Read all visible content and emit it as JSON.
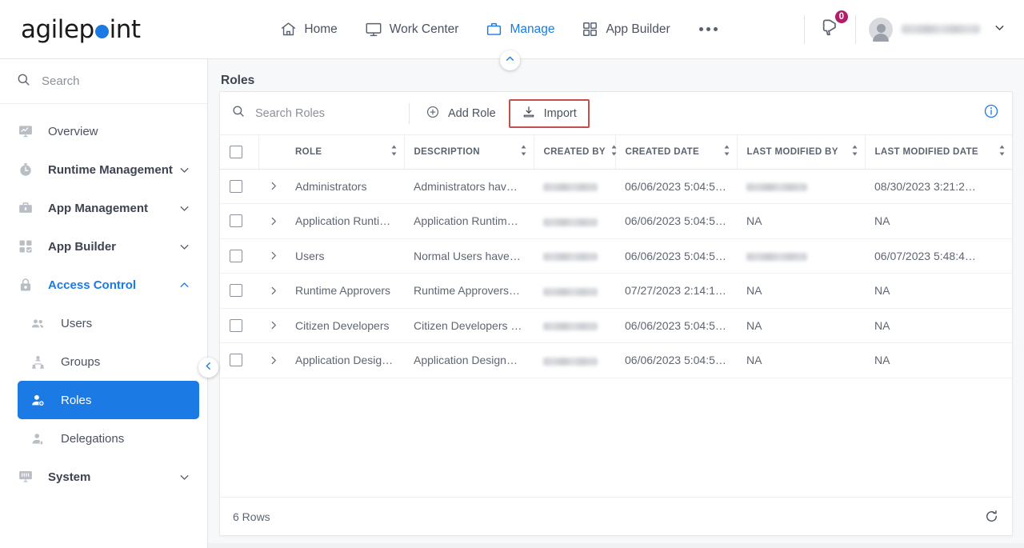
{
  "header": {
    "logo_text_pre": "agilep",
    "logo_text_post": "int",
    "nav": [
      {
        "label": "Home",
        "icon": "home-icon",
        "active": false
      },
      {
        "label": "Work Center",
        "icon": "monitor-icon",
        "active": false
      },
      {
        "label": "Manage",
        "icon": "briefcase-icon",
        "active": true
      },
      {
        "label": "App Builder",
        "icon": "grid-icon",
        "active": false
      }
    ],
    "overflow_label": "more-options",
    "notification_badge": "0",
    "notification_icon": "megaphone-icon",
    "avatar_icon": "user-avatar",
    "user_chevron": "chevron-down-icon"
  },
  "sidebar": {
    "search_placeholder": "Search",
    "items": [
      {
        "label": "Overview",
        "icon": "overview-icon",
        "expandable": false,
        "state": ""
      },
      {
        "label": "Runtime Management",
        "icon": "clock-icon",
        "expandable": true,
        "state": "collapsed"
      },
      {
        "label": "App Management",
        "icon": "toolbox-icon",
        "expandable": true,
        "state": "collapsed"
      },
      {
        "label": "App Builder",
        "icon": "grid-icon",
        "expandable": true,
        "state": "collapsed"
      },
      {
        "label": "Access Control",
        "icon": "lock-icon",
        "expandable": true,
        "state": "expanded"
      }
    ],
    "sub_items": [
      {
        "label": "Users",
        "icon": "users-icon",
        "selected": false
      },
      {
        "label": "Groups",
        "icon": "group-icon",
        "selected": false
      },
      {
        "label": "Roles",
        "icon": "role-user-icon",
        "selected": true
      },
      {
        "label": "Delegations",
        "icon": "delegation-icon",
        "selected": false
      }
    ],
    "system": {
      "label": "System",
      "icon": "system-icon",
      "state": "collapsed"
    },
    "collapse_icon": "chevron-left-icon"
  },
  "content": {
    "page_title": "Roles",
    "collapse_top_icon": "chevron-up-icon",
    "toolbar": {
      "search_placeholder": "Search Roles",
      "search_icon": "search-icon",
      "add_role_label": "Add Role",
      "add_role_icon": "plus-circle-icon",
      "import_label": "Import",
      "import_icon": "download-icon",
      "import_highlight_color": "#c0504d",
      "info_icon": "info-circle-icon"
    },
    "table": {
      "columns": [
        {
          "label": "ROLE",
          "sortable": true
        },
        {
          "label": "DESCRIPTION",
          "sortable": true
        },
        {
          "label": "CREATED BY",
          "sortable": true
        },
        {
          "label": "CREATED DATE",
          "sortable": true
        },
        {
          "label": "LAST MODIFIED BY",
          "sortable": true
        },
        {
          "label": "LAST MODIFIED DATE",
          "sortable": true
        }
      ],
      "rows": [
        {
          "role": "Administrators",
          "description": "Administrators hav…",
          "created_by": "",
          "created_by_redacted": true,
          "created_date": "06/06/2023 5:04:5…",
          "last_modified_by": "",
          "last_modified_by_redacted": true,
          "last_modified_date": "08/30/2023 3:21:2…"
        },
        {
          "role": "Application Runtim…",
          "description": "Application Runtim…",
          "created_by": "",
          "created_by_redacted": true,
          "created_date": "06/06/2023 5:04:5…",
          "last_modified_by": "NA",
          "last_modified_by_redacted": false,
          "last_modified_date": "NA"
        },
        {
          "role": "Users",
          "description": "Normal Users have…",
          "created_by": "",
          "created_by_redacted": true,
          "created_date": "06/06/2023 5:04:5…",
          "last_modified_by": "",
          "last_modified_by_redacted": true,
          "last_modified_date": "06/07/2023 5:48:4…"
        },
        {
          "role": "Runtime Approvers",
          "description": "Runtime Approvers…",
          "created_by": "",
          "created_by_redacted": true,
          "created_date": "07/27/2023 2:14:1…",
          "last_modified_by": "NA",
          "last_modified_by_redacted": false,
          "last_modified_date": "NA"
        },
        {
          "role": "Citizen Developers",
          "description": "Citizen Developers …",
          "created_by": "",
          "created_by_redacted": true,
          "created_date": "06/06/2023 5:04:5…",
          "last_modified_by": "NA",
          "last_modified_by_redacted": false,
          "last_modified_date": "NA"
        },
        {
          "role": "Application Design…",
          "description": "Application Design…",
          "created_by": "",
          "created_by_redacted": true,
          "created_date": "06/06/2023 5:04:5…",
          "last_modified_by": "NA",
          "last_modified_by_redacted": false,
          "last_modified_date": "NA"
        }
      ]
    },
    "footer": {
      "rows_count": "6 Rows",
      "refresh_icon": "refresh-icon"
    }
  },
  "colors": {
    "accent_blue": "#1b7ae4",
    "badge_magenta": "#b01f6a",
    "highlight_red": "#c0504d",
    "text_gray": "#5f6672"
  }
}
